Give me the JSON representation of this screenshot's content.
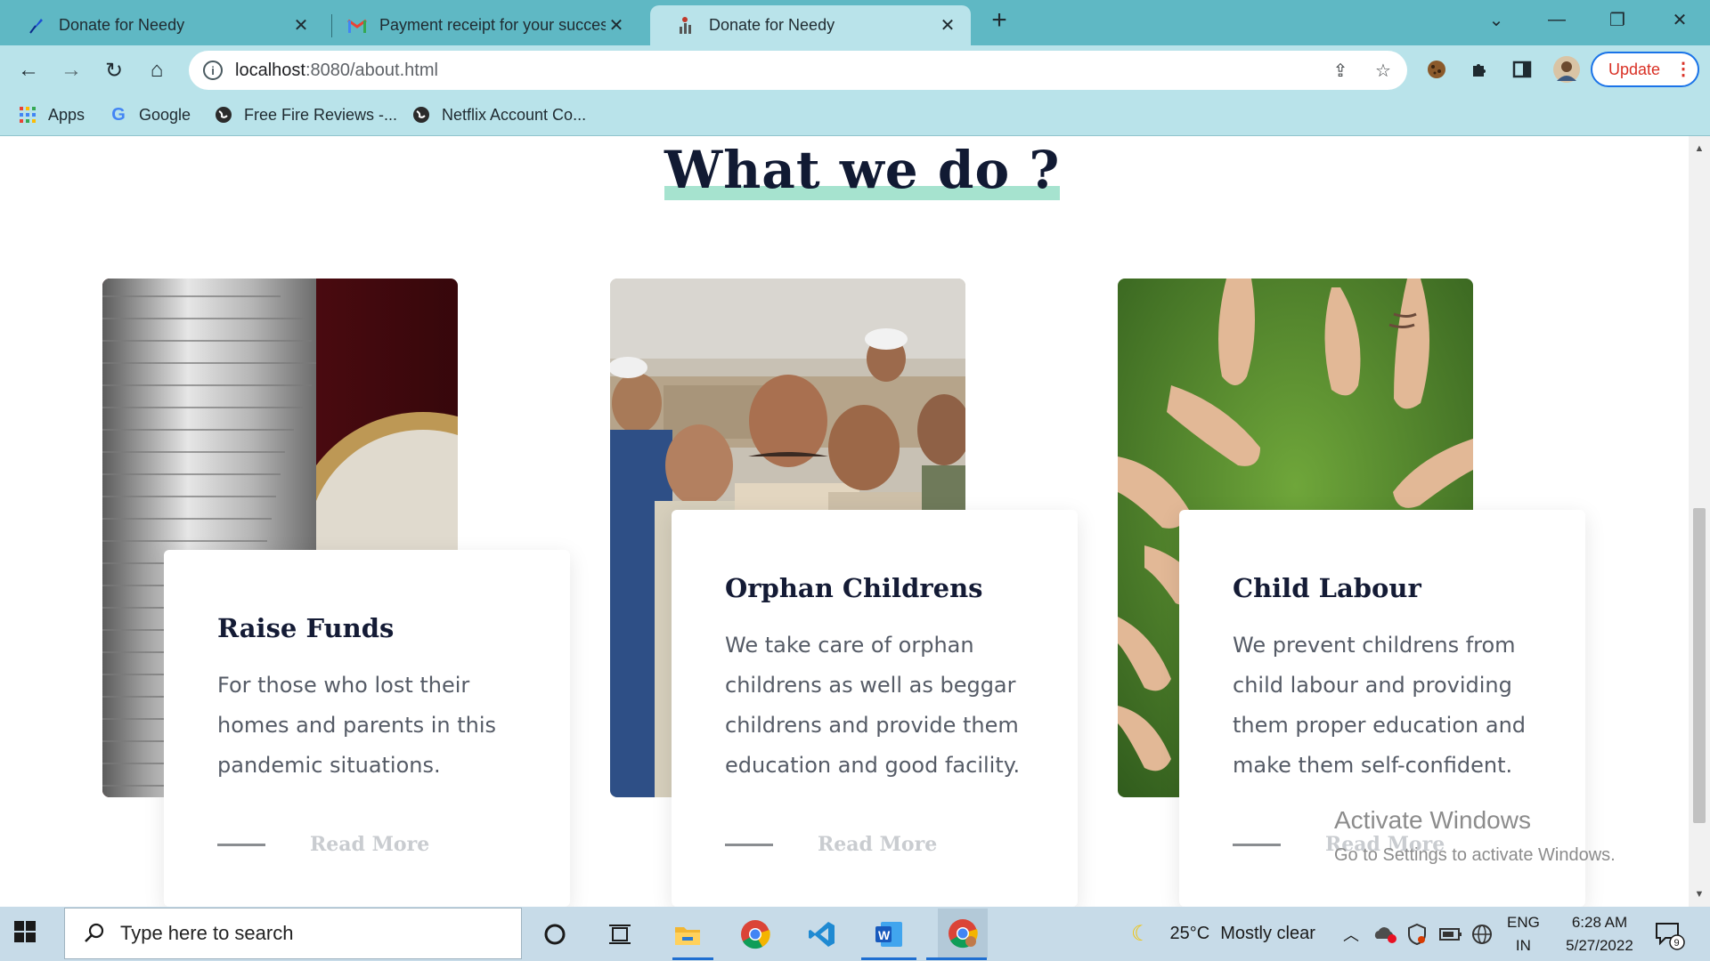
{
  "browser": {
    "tabs": [
      {
        "title": "Donate for Needy",
        "active": false
      },
      {
        "title": "Payment receipt for your successful",
        "active": false
      },
      {
        "title": "Donate for Needy",
        "active": true
      }
    ],
    "address": {
      "host": "localhost",
      "path": ":8080/about.html"
    },
    "update_label": "Update",
    "bookmarks": [
      {
        "label": "Apps"
      },
      {
        "label": "Google"
      },
      {
        "label": "Free Fire Reviews -..."
      },
      {
        "label": "Netflix Account Co..."
      }
    ]
  },
  "page": {
    "heading": "What we do ?",
    "cards": [
      {
        "title": "Raise Funds",
        "text": "For those who lost their homes and parents in this pandemic situations.",
        "more": "Read More",
        "image": "coins-stack-photo"
      },
      {
        "title": "Orphan Childrens",
        "text": "We take care of orphan childrens as well as beggar childrens and provide them education and good facility.",
        "more": "Read More",
        "image": "children-group-photo"
      },
      {
        "title": "Child Labour",
        "text": "We prevent childrens from child labour and providing them proper education and make them self-confident.",
        "more": "Read More",
        "image": "hands-on-grass-photo"
      }
    ],
    "watermark": {
      "line1": "Activate Windows",
      "line2": "Go to Settings to activate Windows."
    }
  },
  "taskbar": {
    "search_placeholder": "Type here to search",
    "weather": {
      "temp": "25°C",
      "condition": "Mostly clear"
    },
    "lang": {
      "line1": "ENG",
      "line2": "IN"
    },
    "clock": {
      "time": "6:28 AM",
      "date": "5/27/2022"
    },
    "notifications": "9"
  },
  "colors": {
    "tabbar": "#5fb8c4",
    "toolbar": "#b9e3ea",
    "heading_highlight": "#a6e3cf",
    "heading_text": "#111a33",
    "taskbar": "#c7dbe8"
  }
}
